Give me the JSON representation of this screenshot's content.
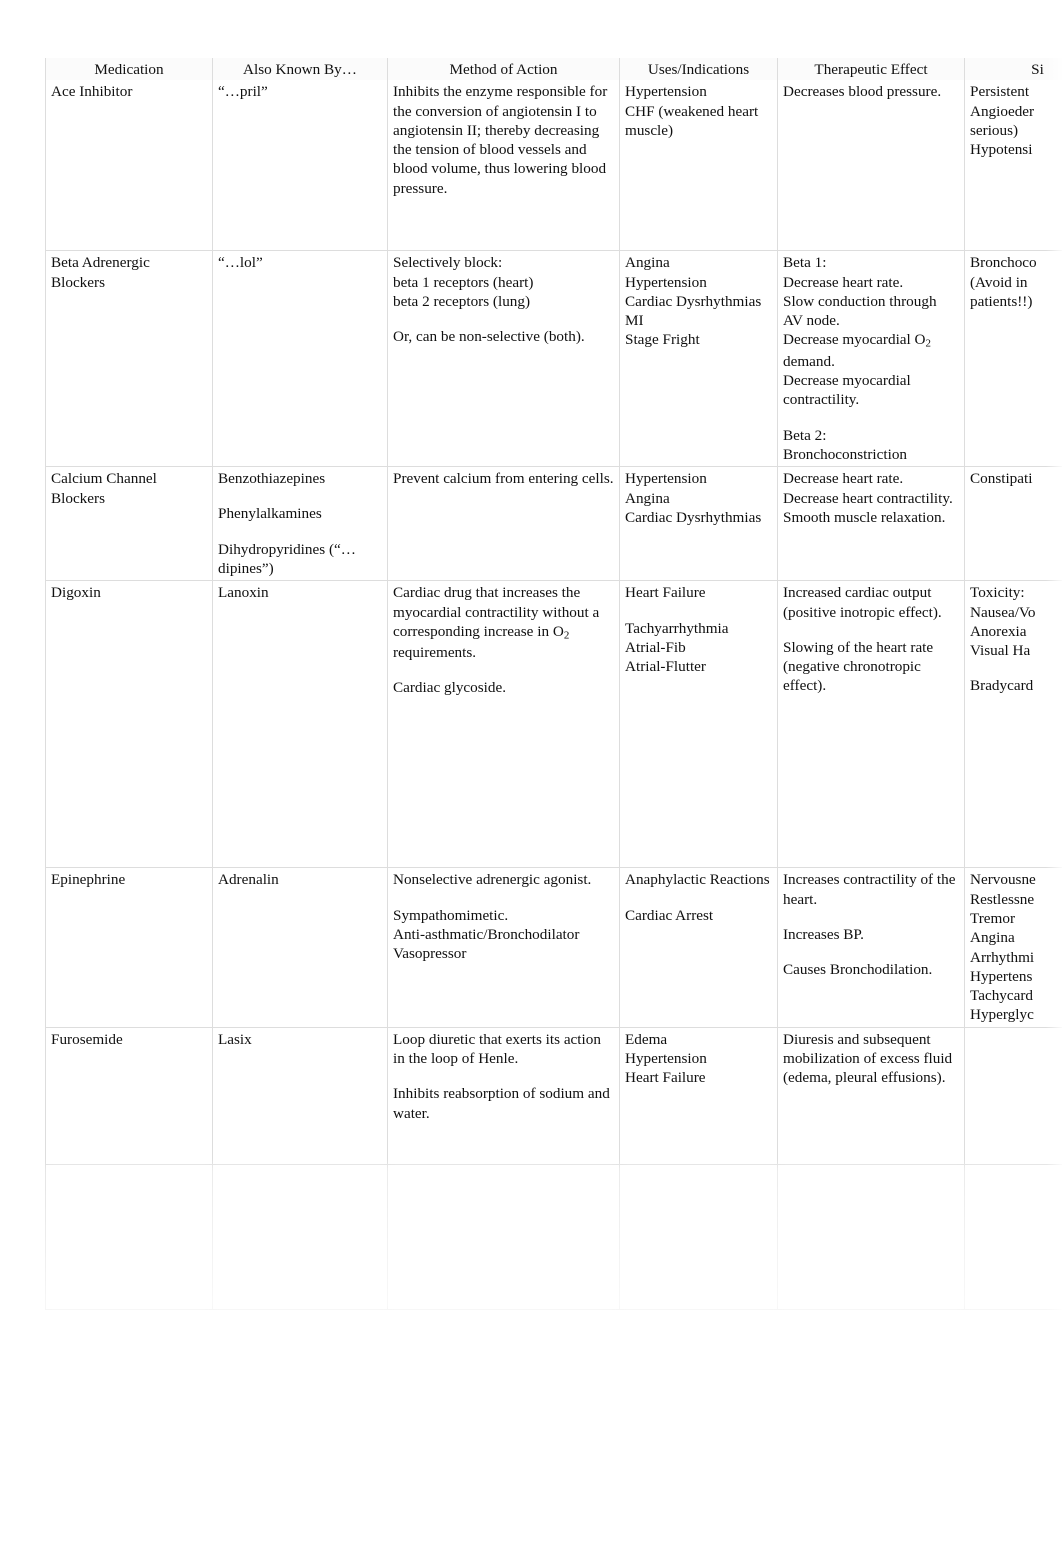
{
  "document": {
    "title": "Cardiac Medication Reference Table",
    "background_color": "#ffffff",
    "text_color": "#101010",
    "grid_color": "#dddddd"
  },
  "table": {
    "columns": [
      "Medication",
      "Also Known By…",
      "Method of Action",
      "Uses/Indications",
      "Therapeutic Effect",
      "Si"
    ],
    "rows": [
      {
        "medication": "Ace Inhibitor",
        "also_known_by": "“…pril”",
        "method_of_action": "Inhibits the enzyme responsible for the conversion of angiotensin I to angiotensin II; thereby decreasing the tension of blood vessels and blood volume, thus lowering blood pressure.",
        "uses_indications": "Hypertension\nCHF (weakened heart muscle)",
        "therapeutic_effect": "Decreases blood pressure.",
        "side_effects": "Persistent\nAngioeder\nserious)\nHypotensi"
      },
      {
        "medication": "Beta Adrenergic Blockers",
        "also_known_by": "“…lol”",
        "method_of_action": "Selectively block:\nbeta 1 receptors (heart)\nbeta 2 receptors (lung)\n\nOr, can be non-selective (both).",
        "uses_indications": "Angina\nHypertension\nCardiac Dysrhythmias\nMI\nStage Fright",
        "therapeutic_effect": "Beta 1:\nDecrease heart rate.\nSlow conduction through AV node.\nDecrease myocardial O₂ demand.\nDecrease myocardial contractility.\n\nBeta 2:\nBronchoconstriction",
        "side_effects": "Bronchoco\n(Avoid in\npatients!!)"
      },
      {
        "medication": "Calcium Channel Blockers",
        "also_known_by": "Benzothiazepines\n\nPhenylalkamines\n\nDihydropyridines (“…dipines”)",
        "method_of_action": "Prevent calcium from entering cells.",
        "uses_indications": "Hypertension\nAngina\nCardiac Dysrhythmias",
        "therapeutic_effect": "Decrease heart rate.\nDecrease heart contractility.\nSmooth muscle relaxation.",
        "side_effects": "Constipati"
      },
      {
        "medication": "Digoxin",
        "also_known_by": "Lanoxin",
        "method_of_action": "Cardiac drug that increases the myocardial contractility without a corresponding increase in O₂ requirements.\n\nCardiac glycoside.",
        "uses_indications": "Heart Failure\n\nTachyarrhythmia\nAtrial-Fib\nAtrial-Flutter",
        "therapeutic_effect": "Increased cardiac output (positive inotropic effect).\n\nSlowing of the heart rate (negative chronotropic effect).",
        "side_effects": "Toxicity:\nNausea/Vo\nAnorexia\nVisual Ha\n\nBradycard"
      },
      {
        "medication": "Epinephrine",
        "also_known_by": "Adrenalin",
        "method_of_action": "Nonselective adrenergic agonist.\n\nSympathomimetic.\nAnti-asthmatic/Bronchodilator\nVasopressor",
        "uses_indications": "Anaphylactic Reactions\n\nCardiac Arrest",
        "therapeutic_effect": "Increases contractility of the heart.\n\nIncreases BP.\n\nCauses Bronchodilation.",
        "side_effects": "Nervousne\nRestlessne\nTremor\nAngina\nArrhythmi\nHypertens\nTachycard\nHyperglyc"
      },
      {
        "medication": "Furosemide",
        "also_known_by": "Lasix",
        "method_of_action": "Loop diuretic that exerts its action in the loop of Henle.\n\nInhibits reabsorption of sodium and water.",
        "uses_indications": "Edema\nHypertension\nHeart Failure",
        "therapeutic_effect": "Diuresis and subsequent mobilization of excess fluid (edema, pleural effusions).",
        "side_effects": ""
      },
      {
        "medication": "",
        "also_known_by": "",
        "method_of_action": "",
        "uses_indications": "",
        "therapeutic_effect": "",
        "side_effects": "",
        "illegible": true
      }
    ]
  }
}
